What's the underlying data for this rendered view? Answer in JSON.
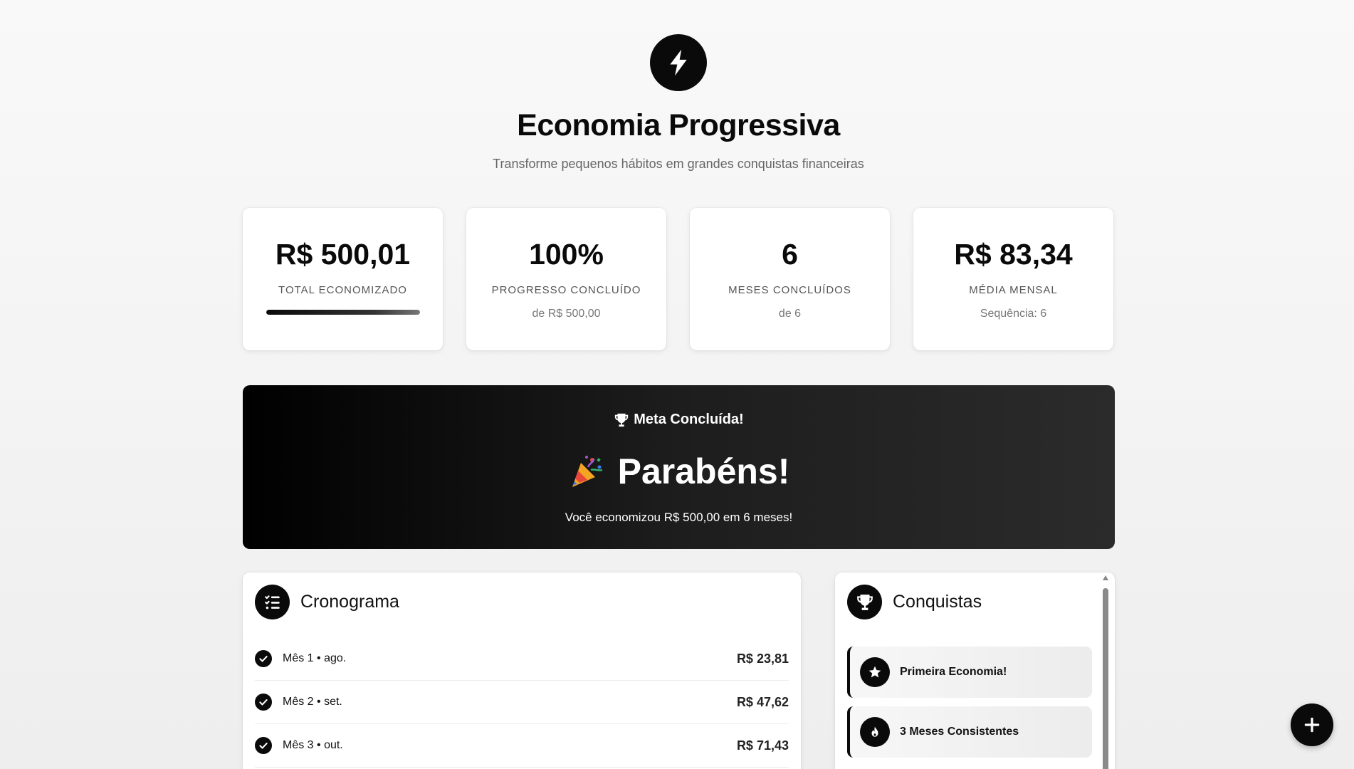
{
  "header": {
    "logo_icon": "lightning-bolt-icon",
    "title": "Economia Progressiva",
    "subtitle": "Transforme pequenos hábitos em grandes conquistas financeiras"
  },
  "stats": {
    "total": {
      "value": "R$ 500,01",
      "label": "TOTAL ECONOMIZADO",
      "progress_fraction": 1.0
    },
    "progress": {
      "value": "100%",
      "label": "PROGRESSO CONCLUÍDO",
      "sub": "de R$ 500,00"
    },
    "months": {
      "value": "6",
      "label": "MESES CONCLUÍDOS",
      "sub": "de 6"
    },
    "average": {
      "value": "R$ 83,34",
      "label": "MÉDIA MENSAL",
      "sub": "Sequência: 6"
    }
  },
  "banner": {
    "tag": "Meta Concluída!",
    "tag_icon": "trophy-icon",
    "title": "Parabéns!",
    "title_icon": "party-popper-icon",
    "text": "Você economizou R$ 500,00 em 6 meses!"
  },
  "schedule": {
    "title": "Cronograma",
    "icon": "checklist-icon",
    "rows": [
      {
        "label": "Mês 1 • ago.",
        "amount": "R$ 23,81",
        "done": true
      },
      {
        "label": "Mês 2 • set.",
        "amount": "R$ 47,62",
        "done": true
      },
      {
        "label": "Mês 3 • out.",
        "amount": "R$ 71,43",
        "done": true
      }
    ]
  },
  "achievements": {
    "title": "Conquistas",
    "icon": "trophy-icon",
    "items": [
      {
        "label": "Primeira Economia!",
        "icon": "star-icon"
      },
      {
        "label": "3 Meses Consistentes",
        "icon": "flame-icon"
      }
    ]
  },
  "fab": {
    "icon": "plus-icon"
  },
  "colors": {
    "primary": "#0a0a0a",
    "background": "#f3f3f3",
    "card": "#ffffff"
  }
}
